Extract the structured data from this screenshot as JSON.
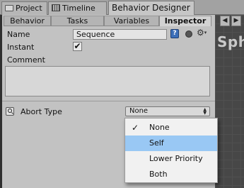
{
  "window_tabs": [
    {
      "label": "Project",
      "icon": "folder-icon"
    },
    {
      "label": "Timeline",
      "icon": "timeline-icon"
    },
    {
      "label": "Behavior Designer",
      "active": true
    }
  ],
  "sub_tabs": [
    {
      "label": "Behavior"
    },
    {
      "label": "Tasks"
    },
    {
      "label": "Variables"
    },
    {
      "label": "Inspector",
      "active": true
    }
  ],
  "scene_partial_text": "Sph",
  "inspector": {
    "name_label": "Name",
    "name_value": "Sequence",
    "help_icon_text": "?",
    "instant_label": "Instant",
    "instant_checked": true,
    "check_glyph": "✔",
    "comment_label": "Comment",
    "comment_value": "",
    "abort_type_label": "Abort Type",
    "abort_type_value": "None"
  },
  "abort_dropdown": {
    "options": [
      {
        "label": "None",
        "checked": true
      },
      {
        "label": "Self",
        "highlighted": true
      },
      {
        "label": "Lower Priority"
      },
      {
        "label": "Both"
      }
    ],
    "check_glyph": "✓"
  },
  "colors": {
    "panel_bg": "#c2c2c2",
    "highlight": "#99c8f4",
    "dark_bg": "#474747"
  }
}
